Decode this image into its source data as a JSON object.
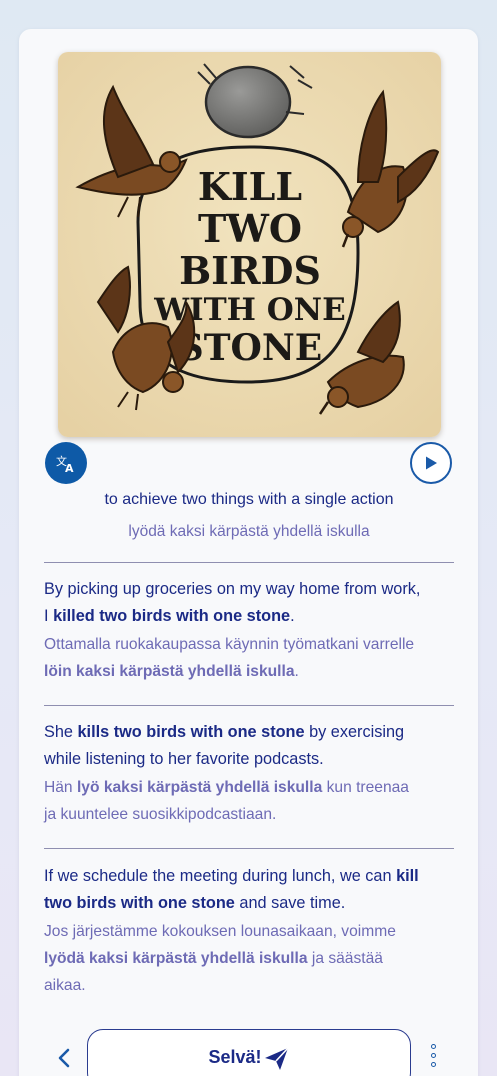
{
  "illustration": {
    "title_lines": [
      "KILL",
      "TWO",
      "BIRDS",
      "WITH ONE",
      "STONE"
    ]
  },
  "icons": {
    "translate": "translate-icon",
    "play": "play-icon",
    "back": "chevron-left-icon",
    "send": "send-icon",
    "more": "more-vertical-icon"
  },
  "meaning": {
    "en": "to achieve two things with a single action",
    "fi": "lyödä kaksi kärpästä yhdellä iskulla"
  },
  "examples": [
    {
      "en": [
        "By picking up groceries on my way home from work,",
        "I ",
        "killed two birds with one stone",
        "."
      ],
      "fi": [
        "Ottamalla ruokakaupassa käynnin työmatkani varrelle",
        "",
        "löin kaksi kärpästä yhdellä iskulla",
        "."
      ]
    },
    {
      "en": [
        "She ",
        "kills two birds with one stone",
        " by exercising",
        "while listening to her favorite podcasts."
      ],
      "fi": [
        "Hän ",
        "lyö kaksi kärpästä yhdellä iskulla",
        " kun treenaa",
        "ja kuuntelee suosikkipodcastiaan."
      ]
    },
    {
      "en": [
        "If we schedule the meeting during lunch, we can ",
        "kill",
        "two birds with one stone",
        " and save time."
      ],
      "fi": [
        "Jos järjestämme kokouksen lounasaikaan, voimme",
        "lyödä kaksi kärpästä yhdellä iskulla",
        " ja säästää",
        "aikaa."
      ]
    }
  ],
  "footer": {
    "primary_label": "Selvä!"
  },
  "colors": {
    "primary": "#1b2a86",
    "secondary": "#6e6bb5",
    "accent": "#0e5aa7",
    "parchment": "#ecdcb4"
  }
}
